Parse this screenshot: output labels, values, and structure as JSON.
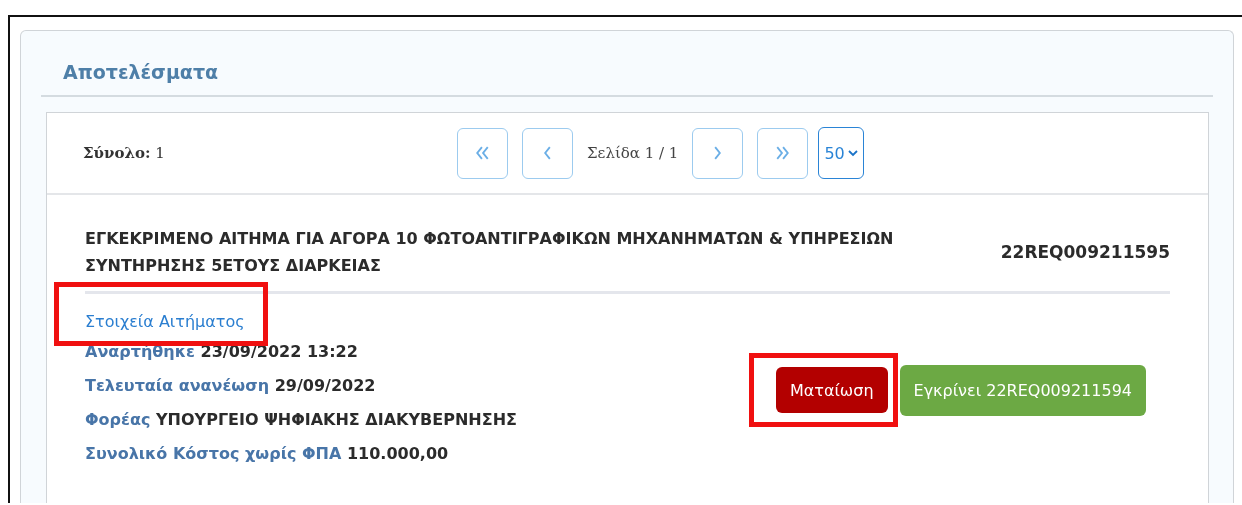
{
  "panel": {
    "title": "Αποτελέσματα"
  },
  "pager": {
    "total_label": "Σύνολο:",
    "total": "1",
    "page_info": "Σελίδα 1 / 1",
    "page_size": "50",
    "buttons": [
      {
        "kind": "first"
      },
      {
        "kind": "prev"
      },
      {
        "kind": "next"
      },
      {
        "kind": "last"
      }
    ]
  },
  "result": {
    "title": "ΕΓΚΕΚΡΙΜΕΝΟ ΑΙΤΗΜΑ ΓΙΑ ΑΓΟΡΑ 10 ΦΩΤΟΑΝΤΙΓΡΑΦΙΚΩΝ ΜΗΧΑΝΗΜΑΤΩΝ & ΥΠΗΡΕΣΙΩΝ ΣΥΝΤΗΡΗΣΗΣ 5ΕΤΟΥΣ ΔΙΑΡΚΕΙΑΣ",
    "code": "22REQ009211595",
    "details_link": {
      "label": "Στοιχεία Αιτήματος",
      "highlighted": true
    },
    "fields": [
      {
        "label": "Αναρτήθηκε",
        "value": "23/09/2022 13:22"
      },
      {
        "label": "Τελευταία ανανέωση",
        "value": "29/09/2022"
      },
      {
        "label": "Φορέας",
        "value": "ΥΠΟΥΡΓΕΙΟ ΨΗΦΙΑΚΗΣ ΔΙΑΚΥΒΕΡΝΗΣΗΣ"
      },
      {
        "label": "Συνολικό Κόστος χωρίς ΦΠΑ",
        "value": "110.000,00"
      }
    ],
    "actions": [
      {
        "label": "Ματαίωση",
        "kind": "cancel",
        "highlighted": true
      },
      {
        "label": "Εγκρίνει 22REQ009211594",
        "kind": "approve",
        "highlighted": false
      }
    ]
  }
}
